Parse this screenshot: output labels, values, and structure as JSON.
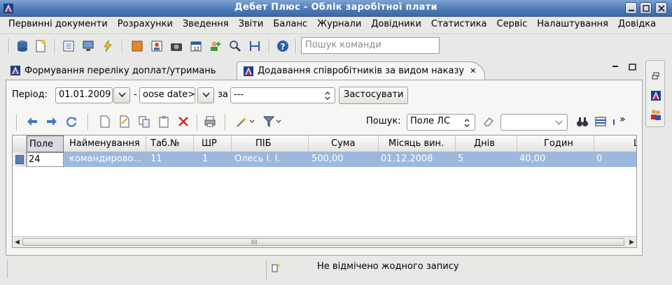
{
  "window": {
    "title": "Дебет Плюс - Облік заробітної плати"
  },
  "menu": [
    "Первинні документи",
    "Розрахунки",
    "Зведення",
    "Звіти",
    "Баланс",
    "Журнали",
    "Довідники",
    "Статистика",
    "Сервіс",
    "Налаштування",
    "Довідка"
  ],
  "toolbar": {
    "command_search_placeholder": "Пошук команди"
  },
  "tabs": [
    {
      "label": "Формування переліку доплат/утримань",
      "active": false
    },
    {
      "label": "Додавання співробітників за видом наказу",
      "active": true
    }
  ],
  "filter": {
    "period_label": "Період:",
    "date_from": "01.01.2009",
    "dash": "-",
    "date_to_placeholder": "oose date>",
    "for_label": "за",
    "for_value": "---",
    "apply_label": "Застосувати"
  },
  "grid_toolbar": {
    "search_label": "Пошук:",
    "search_field": "Поле ЛС",
    "search_value": "",
    "more": "»"
  },
  "table": {
    "columns": [
      "Поле",
      "Найменування",
      "Таб.№",
      "ШР",
      "ПІБ",
      "Сума",
      "Місяць вин.",
      "Днів",
      "Годин",
      "Ш"
    ],
    "rows": [
      [
        "24",
        "командирово...",
        "11",
        "1",
        "Олесь І. І.",
        "500,00",
        "01.12.2008",
        "5",
        "40,00",
        "0"
      ]
    ]
  },
  "status": {
    "message": "Не відмічено жодного запису"
  },
  "colors": {
    "title_bar": "#4f7cb8",
    "selected_row": "#9cb8de",
    "background": "#e8e8e6"
  }
}
